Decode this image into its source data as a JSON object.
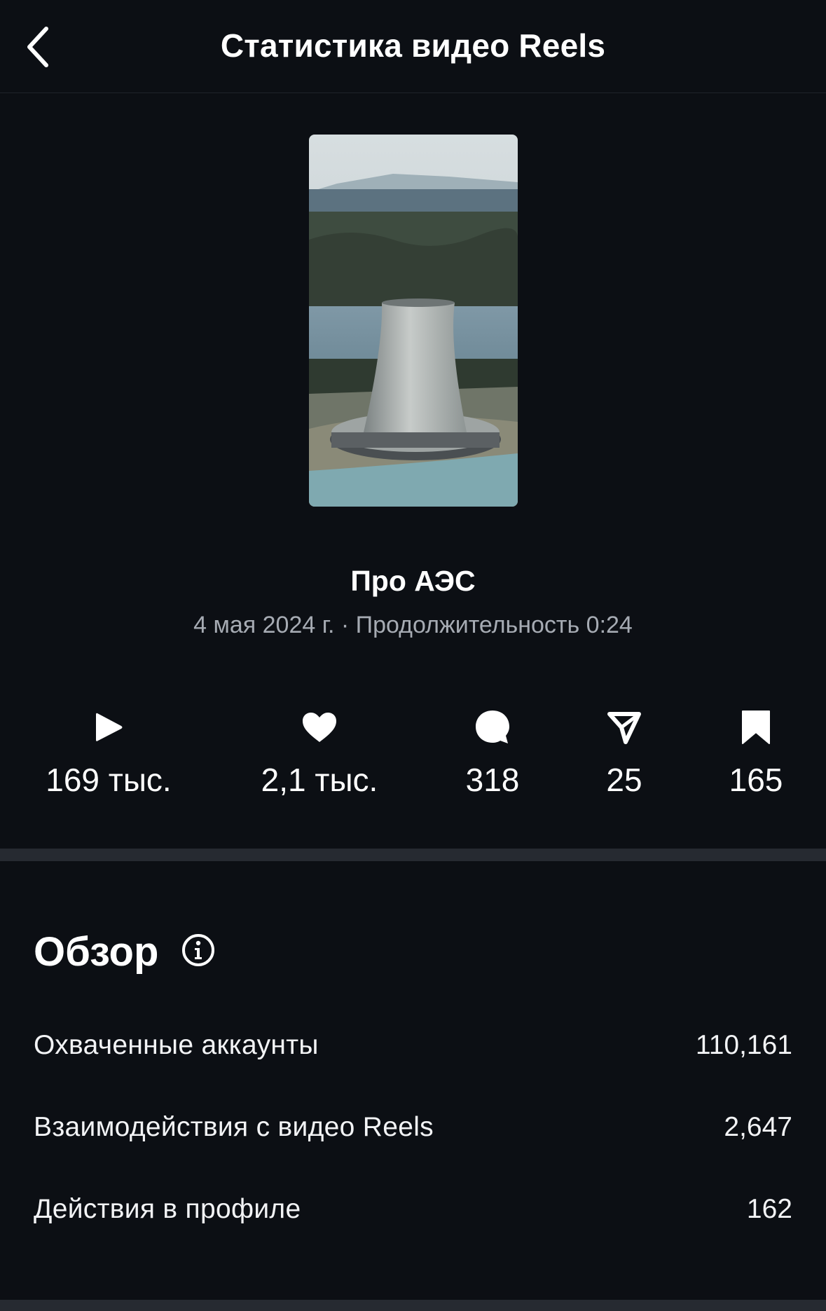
{
  "header": {
    "title": "Статистика видео Reels"
  },
  "reel": {
    "title": "Про АЭС",
    "date": "4 мая 2024 г.",
    "separator": "·",
    "duration_label": "Продолжительность 0:24",
    "meta_line": "4 мая 2024 г. · Продолжительность 0:24"
  },
  "metrics": [
    {
      "icon": "play-icon",
      "value": "169 тыс."
    },
    {
      "icon": "heart-icon",
      "value": "2,1 тыс."
    },
    {
      "icon": "comment-icon",
      "value": "318"
    },
    {
      "icon": "share-icon",
      "value": "25"
    },
    {
      "icon": "bookmark-icon",
      "value": "165"
    }
  ],
  "overview": {
    "title": "Обзор",
    "rows": [
      {
        "label": "Охваченные аккаунты",
        "value": "110,161"
      },
      {
        "label": "Взаимодействия с видео Reels",
        "value": "2,647"
      },
      {
        "label": "Действия в профиле",
        "value": "162"
      }
    ]
  },
  "colors": {
    "background": "#0c0f14",
    "divider": "#262a31",
    "text_primary": "#ffffff",
    "text_secondary": "#a6abb3"
  }
}
